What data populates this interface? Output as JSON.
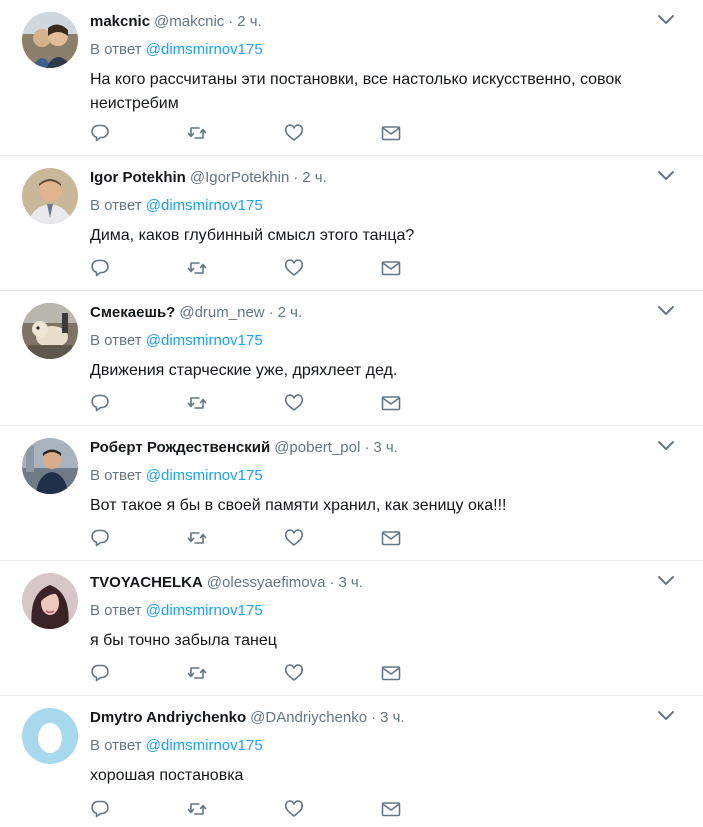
{
  "reply_prefix": "В ответ",
  "tweets": [
    {
      "fullname": "makcnic",
      "screen_name": "@makcnic",
      "time": "2 ч.",
      "mention": "@dimsmirnov175",
      "text": "На кого рассчитаны эти постановки, все настолько искусственно, совок неистребим",
      "avatar": "photo-couple-avatar"
    },
    {
      "fullname": "Igor Potekhin",
      "screen_name": "@IgorPotekhin",
      "time": "2 ч.",
      "mention": "@dimsmirnov175",
      "text": "Дима, каков глубинный смысл этого танца?",
      "avatar": "photo-man-avatar"
    },
    {
      "fullname": "Смекаешь?",
      "screen_name": "@drum_new",
      "time": "2 ч.",
      "mention": "@dimsmirnov175",
      "text": "Движения старческие уже, дряхлеет дед.",
      "avatar": "photo-dog-avatar"
    },
    {
      "fullname": "Роберт Рождественский",
      "screen_name": "@pobert_pol",
      "time": "3 ч.",
      "mention": "@dimsmirnov175",
      "text": "Вот такое я бы в своей памяти хранил, как зеницу ока!!!",
      "avatar": "photo-person-avatar"
    },
    {
      "fullname": "TVOYACHELKA",
      "screen_name": "@olessyaefimova",
      "time": "3 ч.",
      "mention": "@dimsmirnov175",
      "text": "я бы точно забыла танец",
      "avatar": "photo-woman-avatar"
    },
    {
      "fullname": "Dmytro Andriychenko",
      "screen_name": "@DAndriychenko",
      "time": "3 ч.",
      "mention": "@dimsmirnov175",
      "text": "хорошая постановка",
      "avatar": "egg-avatar"
    }
  ],
  "colors": {
    "link": "#1da1f2",
    "muted": "#657786",
    "text": "#14171a",
    "divider": "#e6ecf0",
    "icon": "#657786"
  }
}
